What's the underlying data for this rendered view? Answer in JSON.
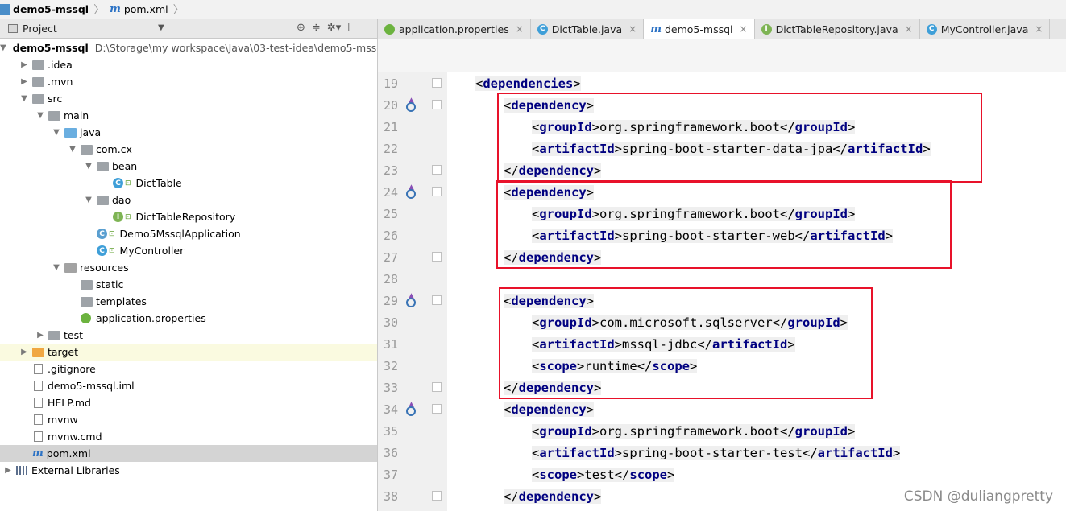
{
  "breadcrumb": [
    {
      "label": "demo5-mssql",
      "icon": "project-folder-icon"
    },
    {
      "label": "pom.xml",
      "icon": "maven-file-icon"
    }
  ],
  "project_panel": {
    "title": "Project",
    "tools": [
      "target-icon",
      "collapse-icon",
      "settings-icon",
      "hide-icon"
    ],
    "tree": [
      {
        "label": "demo5-mssql",
        "path": "D:\\Storage\\my workspace\\Java\\03-test-idea\\demo5-mssq",
        "level": 0,
        "kind": "module",
        "expanded": true
      },
      {
        "label": ".idea",
        "level": 1,
        "kind": "folder",
        "expanded": false
      },
      {
        "label": ".mvn",
        "level": 1,
        "kind": "folder",
        "expanded": false
      },
      {
        "label": "src",
        "level": 1,
        "kind": "folder",
        "expanded": true
      },
      {
        "label": "main",
        "level": 2,
        "kind": "folder",
        "expanded": true
      },
      {
        "label": "java",
        "level": 3,
        "kind": "source-folder",
        "expanded": true
      },
      {
        "label": "com.cx",
        "level": 4,
        "kind": "package",
        "expanded": true
      },
      {
        "label": "bean",
        "level": 5,
        "kind": "package",
        "expanded": true
      },
      {
        "label": "DictTable",
        "level": 6,
        "kind": "class"
      },
      {
        "label": "dao",
        "level": 5,
        "kind": "package",
        "expanded": true
      },
      {
        "label": "DictTableRepository",
        "level": 6,
        "kind": "interface"
      },
      {
        "label": "Demo5MssqlApplication",
        "level": 5,
        "kind": "spring-app"
      },
      {
        "label": "MyController",
        "level": 5,
        "kind": "class"
      },
      {
        "label": "resources",
        "level": 3,
        "kind": "resources-folder",
        "expanded": true
      },
      {
        "label": "static",
        "level": 4,
        "kind": "folder"
      },
      {
        "label": "templates",
        "level": 4,
        "kind": "folder"
      },
      {
        "label": "application.properties",
        "level": 4,
        "kind": "spring-config"
      },
      {
        "label": "test",
        "level": 2,
        "kind": "folder",
        "expanded": false
      },
      {
        "label": "target",
        "level": 1,
        "kind": "excluded-folder",
        "expanded": false
      },
      {
        "label": ".gitignore",
        "level": 1,
        "kind": "file"
      },
      {
        "label": "demo5-mssql.iml",
        "level": 1,
        "kind": "file"
      },
      {
        "label": "HELP.md",
        "level": 1,
        "kind": "md-file"
      },
      {
        "label": "mvnw",
        "level": 1,
        "kind": "file"
      },
      {
        "label": "mvnw.cmd",
        "level": 1,
        "kind": "file"
      },
      {
        "label": "pom.xml",
        "level": 1,
        "kind": "maven-file",
        "selected": true
      },
      {
        "label": "External Libraries",
        "level": 0,
        "kind": "libraries",
        "expanded": false
      }
    ]
  },
  "tabs": [
    {
      "label": "application.properties",
      "icon": "spring-config-icon",
      "active": false
    },
    {
      "label": "DictTable.java",
      "icon": "class-icon",
      "active": false
    },
    {
      "label": "demo5-mssql",
      "icon": "maven-file-icon",
      "active": true
    },
    {
      "label": "DictTableRepository.java",
      "icon": "interface-icon",
      "active": false
    },
    {
      "label": "MyController.java",
      "icon": "class-icon",
      "active": false
    }
  ],
  "code_lines": [
    {
      "num": "19",
      "indent": 0,
      "tag": "dependencies",
      "type": "open",
      "marker": false
    },
    {
      "num": "20",
      "indent": 1,
      "tag": "dependency",
      "type": "open",
      "marker": true
    },
    {
      "num": "21",
      "indent": 2,
      "tag": "groupId",
      "type": "elem",
      "text": "org.springframework.boot"
    },
    {
      "num": "22",
      "indent": 2,
      "tag": "artifactId",
      "type": "elem",
      "text": "spring-boot-starter-data-jpa"
    },
    {
      "num": "23",
      "indent": 1,
      "tag": "dependency",
      "type": "close"
    },
    {
      "num": "24",
      "indent": 1,
      "tag": "dependency",
      "type": "open",
      "marker": true
    },
    {
      "num": "25",
      "indent": 2,
      "tag": "groupId",
      "type": "elem",
      "text": "org.springframework.boot"
    },
    {
      "num": "26",
      "indent": 2,
      "tag": "artifactId",
      "type": "elem",
      "text": "spring-boot-starter-web"
    },
    {
      "num": "27",
      "indent": 1,
      "tag": "dependency",
      "type": "close"
    },
    {
      "num": "28",
      "indent": 0,
      "type": "blank"
    },
    {
      "num": "29",
      "indent": 1,
      "tag": "dependency",
      "type": "open",
      "marker": true
    },
    {
      "num": "30",
      "indent": 2,
      "tag": "groupId",
      "type": "elem",
      "text": "com.microsoft.sqlserver"
    },
    {
      "num": "31",
      "indent": 2,
      "tag": "artifactId",
      "type": "elem",
      "text": "mssql-jdbc"
    },
    {
      "num": "32",
      "indent": 2,
      "tag": "scope",
      "type": "elem",
      "text": "runtime"
    },
    {
      "num": "33",
      "indent": 1,
      "tag": "dependency",
      "type": "close"
    },
    {
      "num": "34",
      "indent": 1,
      "tag": "dependency",
      "type": "open",
      "marker": true
    },
    {
      "num": "35",
      "indent": 2,
      "tag": "groupId",
      "type": "elem",
      "text": "org.springframework.boot"
    },
    {
      "num": "36",
      "indent": 2,
      "tag": "artifactId",
      "type": "elem",
      "text": "spring-boot-starter-test"
    },
    {
      "num": "37",
      "indent": 2,
      "tag": "scope",
      "type": "elem",
      "text": "test"
    },
    {
      "num": "38",
      "indent": 1,
      "tag": "dependency",
      "type": "close"
    }
  ],
  "highlight_color": "#e8122a",
  "watermark": "CSDN @duliangpretty"
}
